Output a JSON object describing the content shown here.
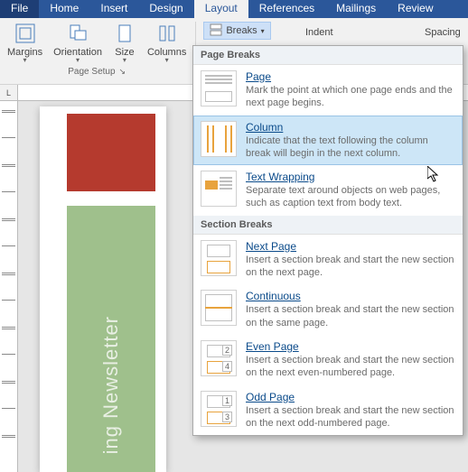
{
  "tabs": [
    "File",
    "Home",
    "Insert",
    "Design",
    "Layout",
    "References",
    "Mailings",
    "Review"
  ],
  "active_tab": "Layout",
  "ribbon": {
    "page_setup": {
      "margins": "Margins",
      "orientation": "Orientation",
      "size": "Size",
      "columns": "Columns",
      "label": "Page Setup"
    },
    "breaks_btn": "Breaks",
    "indent_label": "Indent",
    "spacing_label": "Spacing"
  },
  "corner": "L",
  "newsletter_text": "ing Newsletter",
  "dropdown": {
    "section1_header": "Page Breaks",
    "page": {
      "title": "Page",
      "desc": "Mark the point at which one page ends and the next page begins."
    },
    "column": {
      "title": "Column",
      "desc": "Indicate that the text following the column break will begin in the next column."
    },
    "textwrap": {
      "title": "Text Wrapping",
      "desc": "Separate text around objects on web pages, such as caption text from body text."
    },
    "section2_header": "Section Breaks",
    "nextpage": {
      "title": "Next Page",
      "desc": "Insert a section break and start the new section on the next page."
    },
    "continuous": {
      "title": "Continuous",
      "desc": "Insert a section break and start the new section on the same page."
    },
    "evenpage": {
      "title": "Even Page",
      "desc": "Insert a section break and start the new section on the next even-numbered page.",
      "marks": [
        "2",
        "4"
      ]
    },
    "oddpage": {
      "title": "Odd Page",
      "desc": "Insert a section break and start the new section on the next odd-numbered page.",
      "marks": [
        "1",
        "3"
      ]
    }
  }
}
